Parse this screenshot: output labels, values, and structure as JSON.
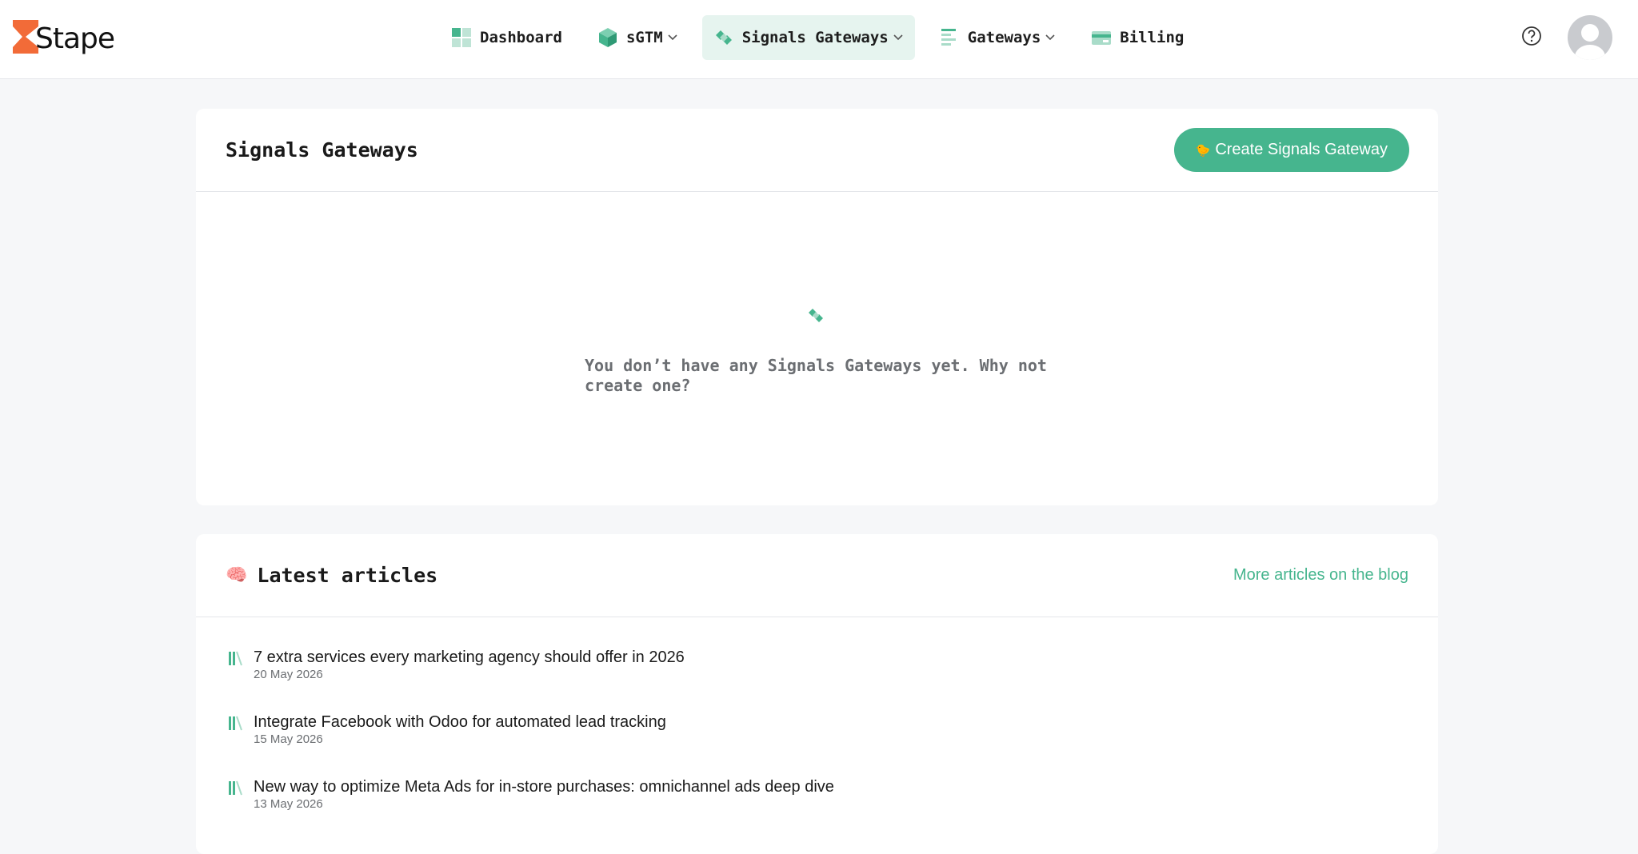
{
  "logo": {
    "text": "Stape"
  },
  "nav": {
    "items": [
      {
        "label": "Dashboard",
        "icon": "dashboard-icon"
      },
      {
        "label": "sGTM",
        "icon": "cube-icon",
        "dropdown": true
      },
      {
        "label": "Signals Gateways",
        "icon": "signals-gateway-icon",
        "dropdown": true,
        "active": true
      },
      {
        "label": "Gateways",
        "icon": "gateways-icon",
        "dropdown": true
      },
      {
        "label": "Billing",
        "icon": "credit-card-icon"
      }
    ]
  },
  "header": {
    "help_icon": "question-circle-icon",
    "avatar_icon": "user-avatar-icon"
  },
  "main": {
    "title": "Signals Gateways",
    "create_button": {
      "emoji": "🐤",
      "label": "Create Signals Gateway"
    },
    "empty_state": {
      "icon": "signals-gateway-icon",
      "text": "You don’t have any Signals Gateways yet. Why not create one?"
    }
  },
  "articles": {
    "emoji": "🧠",
    "title": "Latest articles",
    "more_link": "More articles on the blog",
    "items": [
      {
        "title": "7 extra services every marketing agency should offer in 2026",
        "date": "20 May 2026"
      },
      {
        "title": "Integrate Facebook with Odoo for automated lead tracking",
        "date": "15 May 2026"
      },
      {
        "title": "New way to optimize Meta Ads for in-store purchases: omnichannel ads deep dive",
        "date": "13 May 2026"
      }
    ]
  },
  "colors": {
    "accent": "#46b58e",
    "accent_light": "#e6f4ef",
    "logo_orange": "#f26b38",
    "background": "#f6f7f9"
  }
}
